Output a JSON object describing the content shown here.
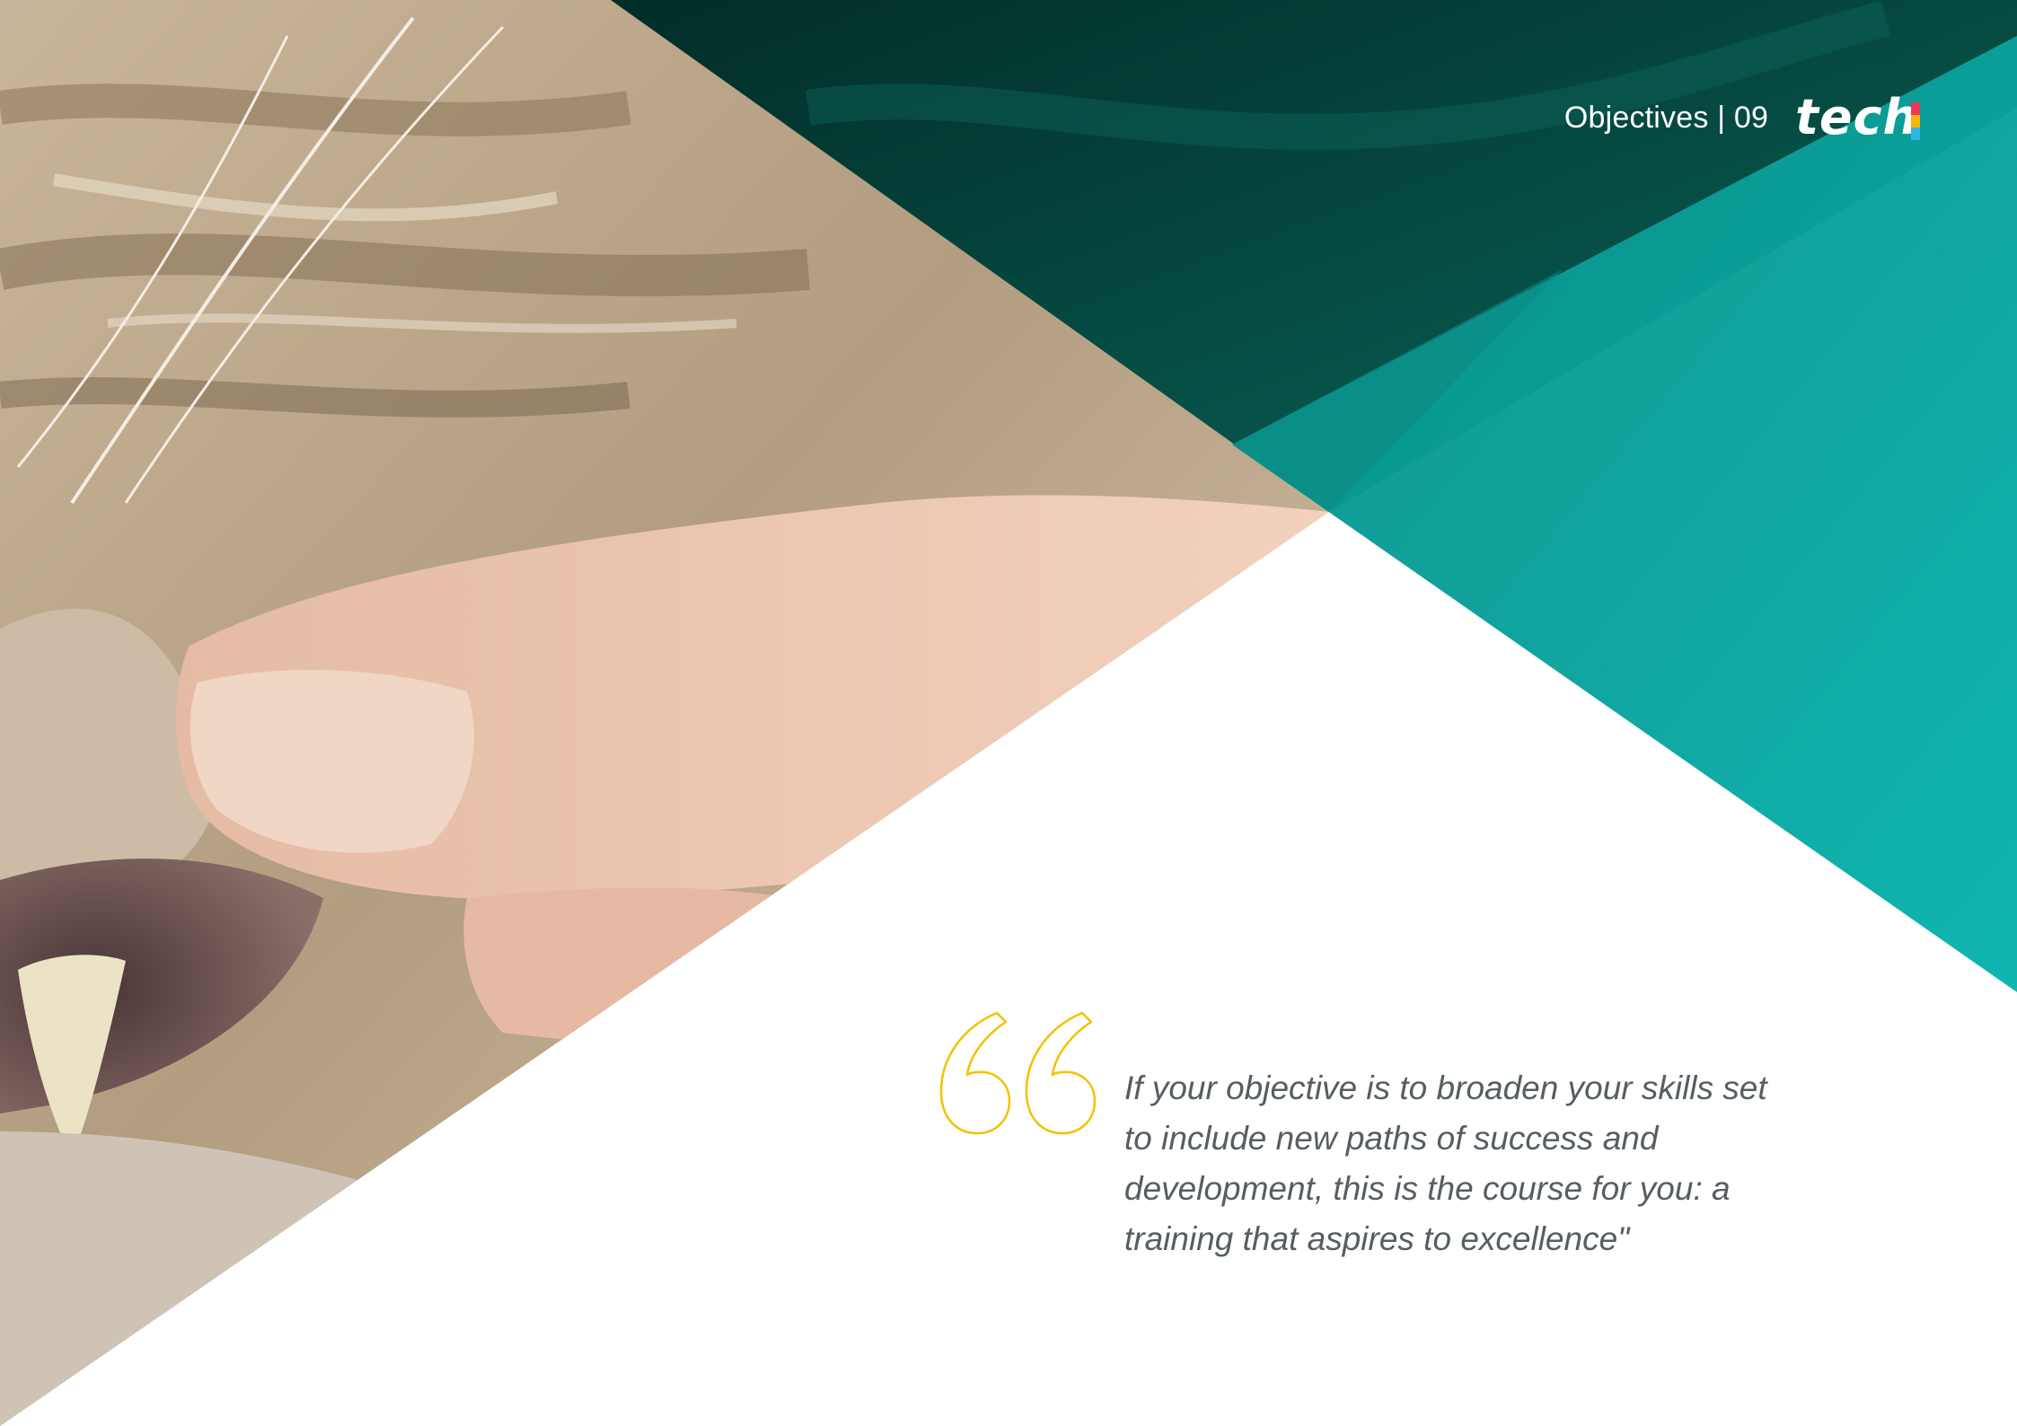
{
  "header": {
    "section_label": "Objectives | 09",
    "logo_text": "tech",
    "logo_bar_colors": [
      "#e83a56",
      "#f5b50a",
      "#2fb5e8"
    ]
  },
  "quote": {
    "icon": "quote-open-icon",
    "icon_color": "#f2c200",
    "text": "If your objective is to broaden your skills set to include new paths of success and development, this is the course for you: a training that aspires to excellence\""
  },
  "colors": {
    "accent_teal": "#0aa9a6",
    "dark_teal": "#03463f",
    "text_gray": "#555e63"
  },
  "images": {
    "photo": "close-up of a tabby cat's face with a hand holding its lip, showing a fang"
  }
}
